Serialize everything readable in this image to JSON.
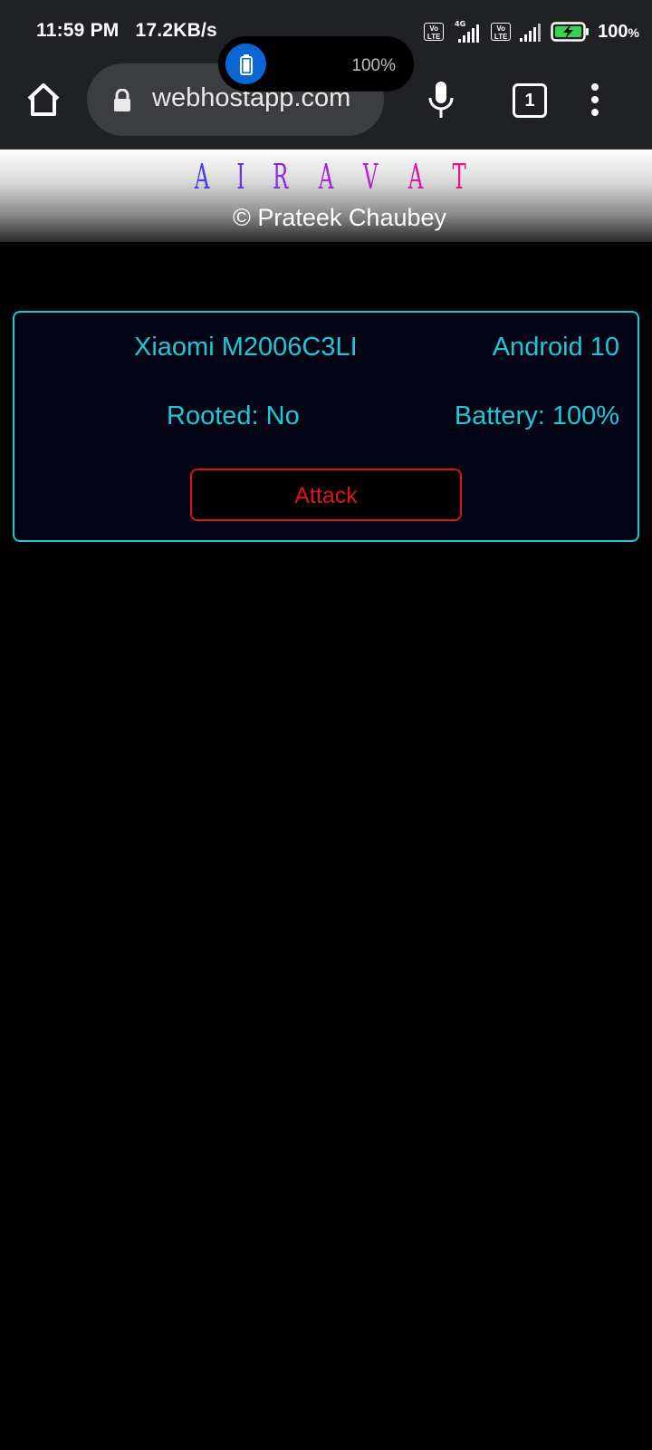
{
  "status_bar": {
    "time": "11:59 PM",
    "speed": "17.2KB/s",
    "volte_label": "Vo LTE",
    "network_label": "4G",
    "battery_percent": "100",
    "battery_unit": "%"
  },
  "overlay": {
    "battery_text": "100%"
  },
  "browser": {
    "url": "webhostapp.com",
    "tab_count": "1"
  },
  "site": {
    "logo_letters": [
      "A",
      "I",
      "R",
      "A",
      "V",
      "A",
      "T"
    ],
    "logo_colors": [
      "#4a3cf0",
      "#6a30ec",
      "#8a2ae6",
      "#a624de",
      "#c01ed2",
      "#d818b4",
      "#ec1280"
    ],
    "copyright": "© Prateek Chaubey"
  },
  "device": {
    "model": "Xiaomi M2006C3LI",
    "os": "Android 10",
    "rooted": "Rooted: No",
    "battery": "Battery: 100%",
    "attack_label": "Attack"
  }
}
